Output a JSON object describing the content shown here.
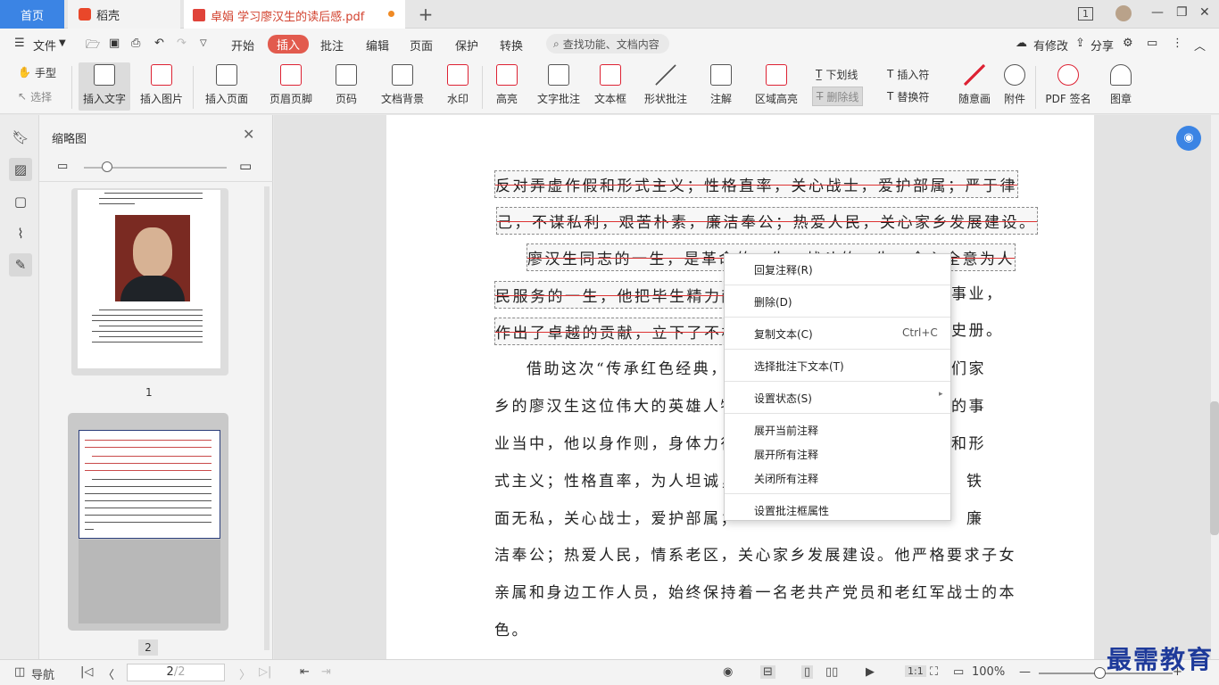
{
  "tabs": {
    "home": "首页",
    "daoke": "稻壳",
    "doc": "卓娟 学习廖汉生的读后感.pdf"
  },
  "window": {
    "page_indicator": "1"
  },
  "menu": {
    "file": "文件",
    "items": [
      "开始",
      "插入",
      "批注",
      "编辑",
      "页面",
      "保护",
      "转换"
    ],
    "active": "插入",
    "search_placeholder": "查找功能、文档内容",
    "modified": "有修改",
    "share": "分享"
  },
  "toolbar": {
    "hand": "手型",
    "select": "选择",
    "insert_text": "插入文字",
    "insert_image": "插入图片",
    "insert_page": "插入页面",
    "header_footer": "页眉页脚",
    "page_number": "页码",
    "doc_background": "文档背景",
    "watermark": "水印",
    "highlight": "高亮",
    "text_annotation": "文字批注",
    "textbox": "文本框",
    "shape_annotation": "形状批注",
    "annotation": "注解",
    "area_highlight": "区域高亮",
    "underline": "下划线",
    "insert_mark": "插入符",
    "strikethrough": "删除线",
    "replace_mark": "替换符",
    "freehand": "随意画",
    "attachment": "附件",
    "pdf_sign": "PDF 签名",
    "stamp": "图章"
  },
  "sidebar": {
    "title": "缩略图",
    "page1_label": "1",
    "page2_label": "2"
  },
  "document": {
    "lines": [
      {
        "text": "反对弄虚作假和形式主义；性格直率，关心战士，爱护部属；严于律",
        "strike": true
      },
      {
        "text": "己，不谋私利，艰苦朴素，廉洁奉公；热爱人民，关心家乡发展建设。",
        "strike": true
      },
      {
        "text": "廖汉生同志的一生，是革命的一生，战斗的一生，全心全意为人",
        "strike": true
      },
      {
        "text": "民服务的一生，他把毕生精力献",
        "strike": true,
        "tail": "事业，"
      },
      {
        "text": "作出了卓越的贡献，立下了不朽",
        "strike": true,
        "tail": "史册。"
      },
      {
        "text": "借助这次“传承红色经典，",
        "tail": "们家"
      },
      {
        "text": "乡的廖汉生这位伟大的英雄人物",
        "tail": "的事"
      },
      {
        "text": "业当中，他以身作则，身体力行",
        "tail": "和形"
      },
      {
        "text": "式主义；性格直率，为人坦诚，",
        "tail": "铁"
      },
      {
        "text": "面无私，关心战士，爱护部属；",
        "tail": "廉"
      },
      {
        "text": "洁奉公；热爱人民，情系老区，关心家乡发展建设。他严格要求子女"
      },
      {
        "text": "亲属和身边工作人员，始终保持着一名老共产党员和老红军战士的本"
      },
      {
        "text": "色。"
      }
    ]
  },
  "context_menu": {
    "reply": "回复注释(R)",
    "delete": "删除(D)",
    "copy": "复制文本(C)",
    "copy_shortcut": "Ctrl+C",
    "select_text": "选择批注下文本(T)",
    "set_status": "设置状态(S)",
    "expand_current": "展开当前注释",
    "expand_all": "展开所有注释",
    "close_all": "关闭所有注释",
    "properties": "设置批注框属性"
  },
  "status": {
    "nav": "导航",
    "page_current": "2",
    "page_total": "/2",
    "zoom": "100%"
  },
  "watermark_text": "最需教育",
  "colors": {
    "accent": "#3b84e4",
    "insert_tab": "#e25b4e",
    "strike": "#d33333"
  }
}
